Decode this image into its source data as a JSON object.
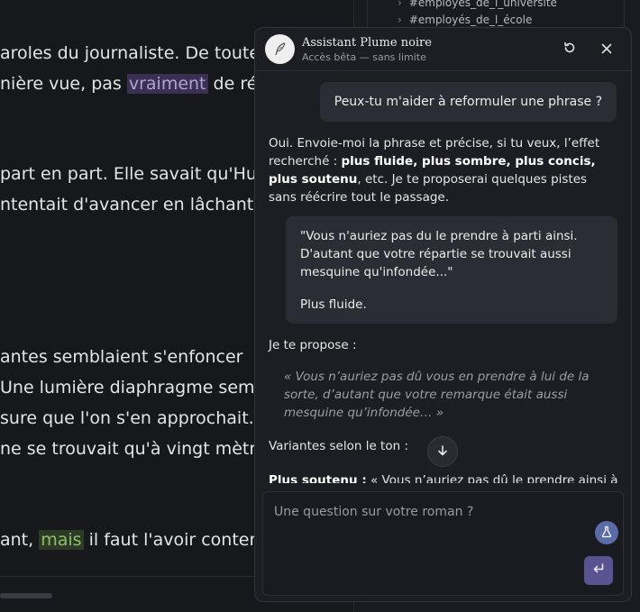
{
  "editor": {
    "line1": "aroles du journaliste. De toute",
    "line2_pre": "nière vue, pas ",
    "line2_hl": "vraiment",
    "line2_post": " de rép",
    "line3": " part en part. Elle savait qu'Hul",
    "line4": "ntentait d'avancer en lâchant",
    "line5": "antes semblaient s'enfoncer",
    "line6": " Une lumière diaphragme semb",
    "line7": "sure que l'on s'en approchait.",
    "line8": " ne se trouvait qu'à vingt mètre",
    "line9_pre": "ant, ",
    "line9_hl": "mais",
    "line9_post": " il faut l'avoir contemp"
  },
  "tags": [
    {
      "chevron": "›",
      "label": "#employés_de_l_université"
    },
    {
      "chevron": "›",
      "label": "#employés_de_l_école"
    }
  ],
  "assistant": {
    "title": "Assistant Plume noire",
    "subtitle": "Accès bêta — sans limite",
    "icons": {
      "logo": "quill-icon",
      "reset": "refresh-icon",
      "close": "close-icon",
      "scroll": "arrow-down-icon",
      "flask": "flask-icon",
      "send": "enter-icon"
    },
    "user_message": "Peux-tu m'aider à reformuler une phrase ?",
    "reply1": {
      "t1": "Oui. Envoie-moi la phrase et précise, si tu veux, l’effet recherché : ",
      "b1": "plus fluide, plus sombre, plus concis, plus soutenu",
      "t2": ", etc. Je te proposerai quelques pistes sans réécrire tout le passage."
    },
    "quote": {
      "text": "\"Vous n'auriez pas du le prendre à parti ainsi. D'autant que votre répartie se trouvait aussi mesquine qu'infondée...\"",
      "instruction": "Plus fluide."
    },
    "propose_label": "Je te propose :",
    "proposal": "« Vous n’auriez pas dû vous en prendre à lui de la sorte, d’autant que votre remarque était aussi mesquine qu’infondée… »",
    "variants_label": "Variantes selon le ton :",
    "cut_bold": "Plus soutenu :",
    "cut_text": " « Vous n’auriez pas dû le prendre ainsi à",
    "composer_placeholder": "Une question sur votre roman ?"
  },
  "colors": {
    "accent": "#5a5390",
    "flask": "#5a6ba8",
    "highlight_purple": "#3a3052",
    "highlight_green": "#2d3a26"
  }
}
